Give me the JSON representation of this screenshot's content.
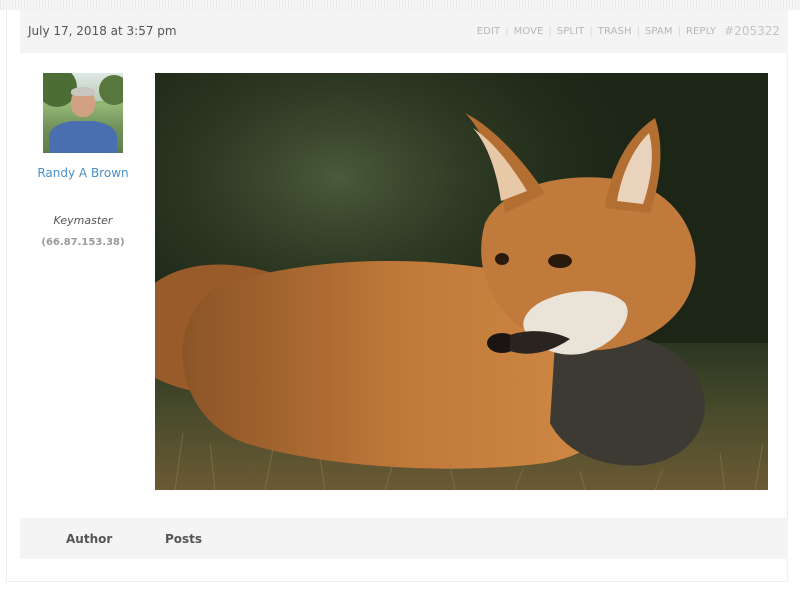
{
  "post": {
    "date": "July 17, 2018 at 3:57 pm",
    "permalink": "#205322",
    "admin_links": [
      "EDIT",
      "MOVE",
      "SPLIT",
      "TRASH",
      "SPAM",
      "REPLY"
    ]
  },
  "author": {
    "name": "Randy A Brown",
    "role": "Keymaster",
    "ip": "(66.87.153.38)"
  },
  "footer": {
    "author_label": "Author",
    "posts_label": "Posts"
  },
  "colors": {
    "link": "#4a90c8",
    "header_bg": "#f4f4f4",
    "muted": "#b7b7b7"
  }
}
